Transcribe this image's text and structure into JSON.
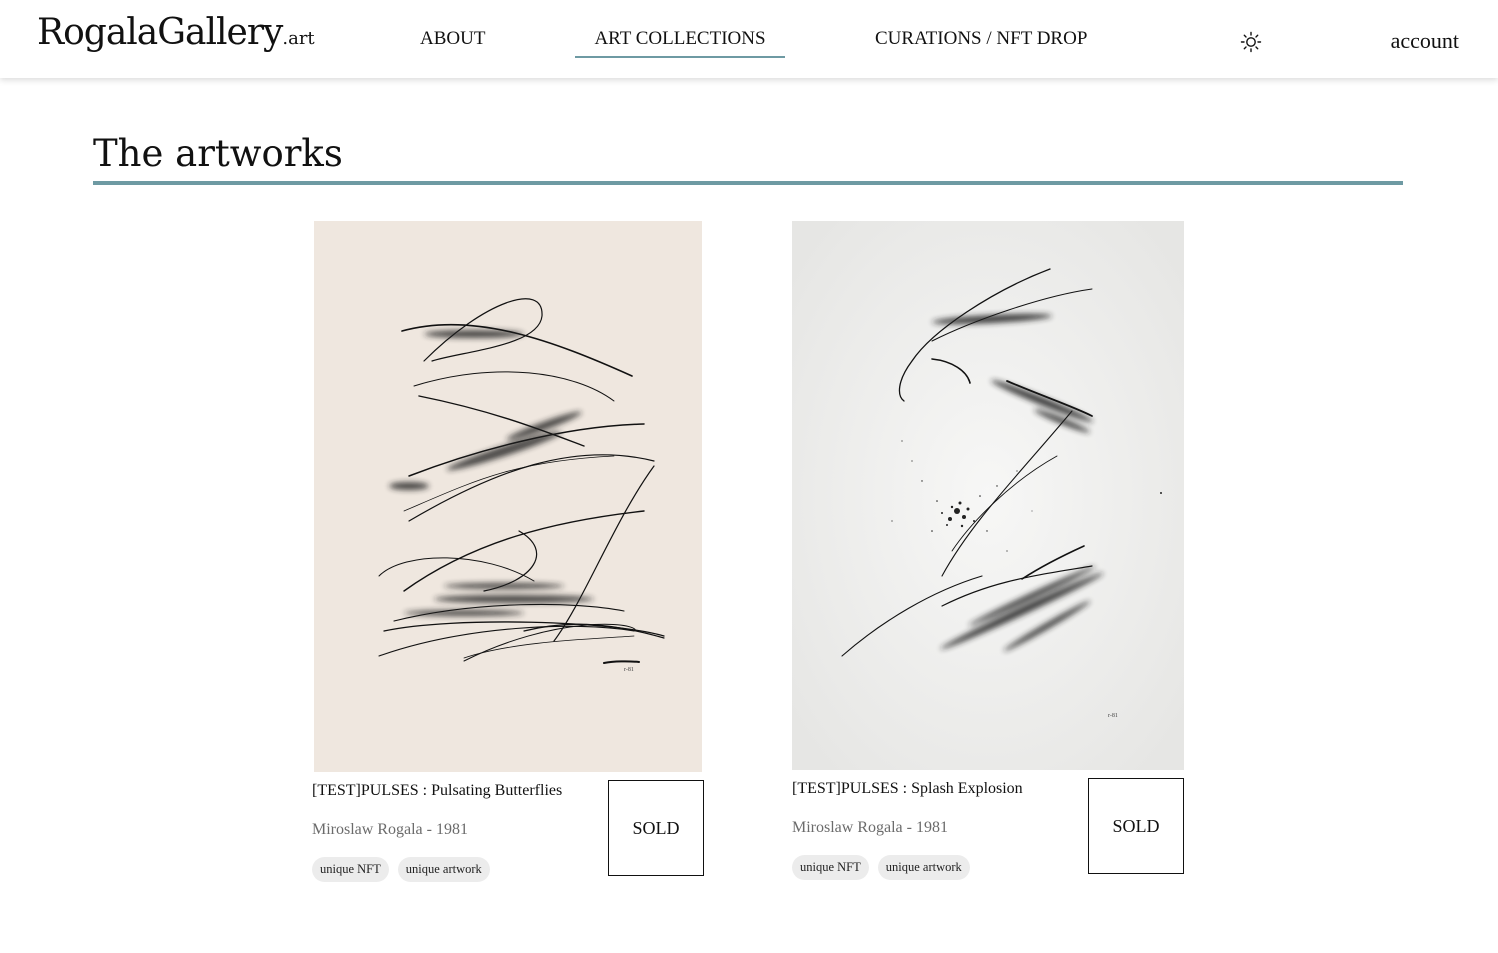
{
  "header": {
    "logo_main": "RogalaGallery",
    "logo_tld": ".art",
    "nav": [
      {
        "label": "ABOUT",
        "active": false
      },
      {
        "label": "ART COLLECTIONS",
        "active": true
      },
      {
        "label": "CURATIONS / NFT DROP",
        "active": false
      }
    ],
    "theme_icon": "sun-icon",
    "account_label": "account"
  },
  "main": {
    "section_title": "The artworks",
    "accent_color": "#6e9aa3",
    "artworks": [
      {
        "title": "[TEST]PULSES : Pulsating Butterflies",
        "artist": "Miroslaw Rogala - 1981",
        "tags": [
          "unique NFT",
          "unique artwork"
        ],
        "status": "SOLD",
        "image_icon": "ink-drawing-image"
      },
      {
        "title": "[TEST]PULSES : Splash Explosion",
        "artist": "Miroslaw Rogala - 1981",
        "tags": [
          "unique NFT",
          "unique artwork"
        ],
        "status": "SOLD",
        "image_icon": "ink-drawing-image"
      }
    ]
  }
}
